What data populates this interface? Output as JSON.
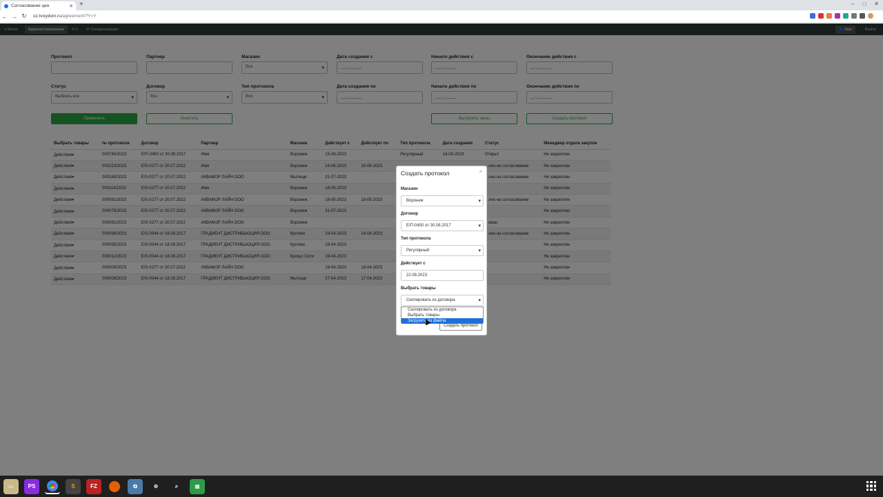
{
  "browser": {
    "tab_title": "Согласование цен",
    "url_host": "oz.tvoydom.ru",
    "url_path": "/agreement/?Y=Y"
  },
  "appnav": {
    "menu": "≡ Меню",
    "admin": "Администрирование",
    "counter": "✉ 2",
    "sync": "⟳ Синхронизация",
    "user": "👤 Имя",
    "logout": "Выйти"
  },
  "filters": {
    "protocol": "Протокол",
    "partner": "Партнер",
    "shop": "Магазин",
    "shop_value": "Все",
    "created_from": "Дата создания с",
    "start_from": "Начало действия с",
    "end_from": "Окончание действия с",
    "status": "Статус",
    "status_value": "Выбрать все",
    "contract": "Договор",
    "contract_value": "Все",
    "protocol_type": "Тип протокола",
    "protocol_type_value": "Все",
    "created_to": "Дата создания по",
    "start_to": "Начало действия по",
    "end_to": "Окончание действия по",
    "date_placeholder": "__.__.____"
  },
  "buttons": {
    "apply": "Применить",
    "clear": "Очистить",
    "export_prices": "Выгрузить цены",
    "create_protocol": "Создать протокол"
  },
  "table": {
    "headers": [
      "Выбрать товары",
      "№ протокола",
      "Договор",
      "Партнер",
      "Магазин",
      "Действует с",
      "Действует по",
      "Тип протокола",
      "Дата создания",
      "Статус",
      "Менеджер отдела закупок"
    ],
    "rows": [
      [
        "Действия▾",
        "000745/2023",
        "Е/П-0450 от 30.08.2017",
        "Имя",
        "Воронеж",
        "15-08-2023",
        "",
        "Регулярный",
        "14-08-2023",
        "Открыт",
        "Не закреплен"
      ],
      [
        "Действия▾",
        "000223/2023",
        "Е/S-0277 от 20.07.2022",
        "Имя",
        "Воронеж",
        "14-06-2023",
        "15-06-2023",
        "",
        "",
        "...лен на согласование",
        "Не закреплен"
      ],
      [
        "Действия▾",
        "000169/2023",
        "Е/S-0277 от 20.07.2022",
        "АКВАФОР ЛАЙН ООО",
        "Мытищи",
        "31-07-2023",
        "",
        "",
        "",
        "...лен на согласование",
        "Не закреплен"
      ],
      [
        "Действия▾",
        "000114/2023",
        "Е/S-0277 от 20.07.2022",
        "Имя",
        "Воронеж",
        "18-05-2023",
        "",
        "",
        "",
        "",
        "Не закреплен"
      ],
      [
        "Действия▾",
        "000081/2023",
        "Е/S-0277 от 20.07.2022",
        "АКВАФОР ЛАЙН ООО",
        "Воронеж",
        "18-05-2023",
        "18-05-2023",
        "",
        "",
        "...лен на согласование",
        "Не закреплен"
      ],
      [
        "Действия▾",
        "000078/2023",
        "Е/S-0277 от 20.07.2022",
        "АКВАФОР ЛАЙН ООО",
        "Воронеж",
        "31-07-2023",
        "",
        "",
        "",
        "",
        "Не закреплен"
      ],
      [
        "Действия▾",
        "000061/2023",
        "Е/S-0277 от 20.07.2022",
        "АКВАФОР ЛАЙН ООО",
        "Воронеж",
        "",
        "",
        "",
        "",
        "...ован",
        "Не закреплен"
      ],
      [
        "Действия▾",
        "000056/2023",
        "Е/S-0044 от 18.08.2017",
        "ГРАДИЕНТ ДИСТРИБЬЮЦИЯ ООО",
        "Кротекс",
        "19-04-2023",
        "14-04-2023",
        "",
        "",
        "...лен на согласование",
        "Не закреплен"
      ],
      [
        "Действия▾",
        "000055/2023",
        "Е/S-0044 от 18.08.2017",
        "ГРАДИЕНТ ДИСТРИБЬЮЦИЯ ООО",
        "Кротекс",
        "19-04-2023",
        "",
        "",
        "",
        "",
        "Не закреплен"
      ],
      [
        "Действия▾",
        "000012/2023",
        "Е/S-0044 от 18.08.2017",
        "ГРАДИЕНТ ДИСТРИБЬЮЦИЯ ООО",
        "Крокус Сити",
        "19-04-2023",
        "",
        "",
        "",
        "",
        "Не закреплен"
      ],
      [
        "Действия▾",
        "000009/2023",
        "Е/S-0277 от 20.07.2022",
        "АКВАФОР ЛАЙН ООО",
        "",
        "19-04-2023",
        "19-04-2023",
        "",
        "",
        "",
        "Не закреплен"
      ],
      [
        "Действия▾",
        "000008/2023",
        "Е/S-0044 от 18.08.2017",
        "ГРАДИЕНТ ДИСТРИБЬЮЦИЯ ООО",
        "Мытищи",
        "27-04-2023",
        "17-04-2023",
        "",
        "",
        "",
        "Не закреплен"
      ]
    ]
  },
  "modal": {
    "title": "Создать протокол",
    "close": "×",
    "shop_label": "Магазин",
    "shop_value": "Воронеж",
    "contract_label": "Договор",
    "contract_value": "Е/П-0450 от 30.08.2017",
    "type_label": "Тип протокола",
    "type_value": "Регулярный",
    "active_from_label": "Действует с",
    "active_from_value": "22.08.2023",
    "goods_label": "Выбрать товары",
    "goods_value": "Скопировать из договора",
    "options": [
      "Скопировать из договора",
      "Выбрать товары",
      "Загрузить из файла"
    ],
    "submit": "Создать протокол"
  },
  "taskbar": {
    "apps": [
      "files",
      "phpstorm",
      "chrome",
      "sublime",
      "filezilla",
      "firefox",
      "network",
      "vpn",
      "search",
      "spreadsheet"
    ]
  }
}
